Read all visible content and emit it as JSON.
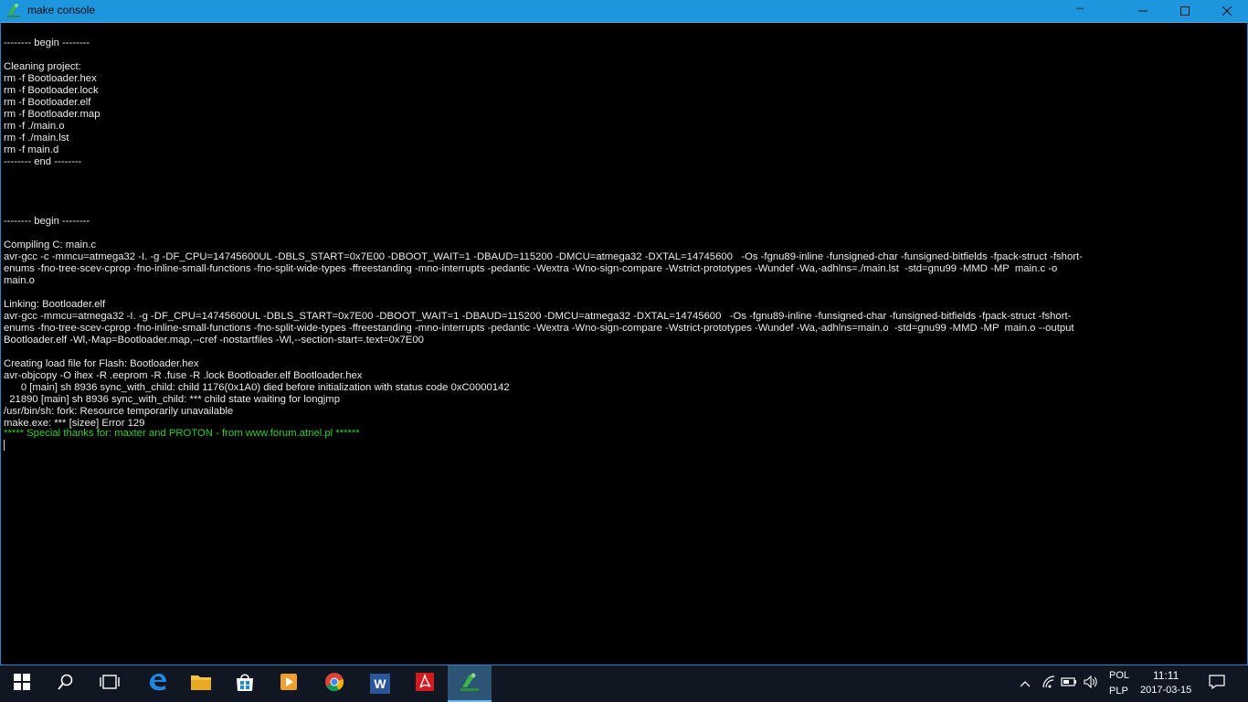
{
  "window": {
    "title": "make console",
    "resize_glyph": "↔",
    "buttons": {
      "minimize": "—",
      "maximize": "☐",
      "close": "✕"
    }
  },
  "console": {
    "lines": [
      "-------- begin --------",
      "",
      "Cleaning project:",
      "rm -f Bootloader.hex",
      "rm -f Bootloader.lock",
      "rm -f Bootloader.elf",
      "rm -f Bootloader.map",
      "rm -f ./main.o",
      "rm -f ./main.lst",
      "rm -f main.d",
      "-------- end --------",
      "",
      "",
      "",
      "",
      "-------- begin --------",
      "",
      "Compiling C: main.c",
      "avr-gcc -c -mmcu=atmega32 -I. -g -DF_CPU=14745600UL -DBLS_START=0x7E00 -DBOOT_WAIT=1 -DBAUD=115200 -DMCU=atmega32 -DXTAL=14745600   -Os -fgnu89-inline -funsigned-char -funsigned-bitfields -fpack-struct -fshort-",
      "enums -fno-tree-scev-cprop -fno-inline-small-functions -fno-split-wide-types -ffreestanding -mno-interrupts -pedantic -Wextra -Wno-sign-compare -Wstrict-prototypes -Wundef -Wa,-adhlns=./main.lst  -std=gnu99 -MMD -MP  main.c -o",
      "main.o",
      "",
      "Linking: Bootloader.elf",
      "avr-gcc -mmcu=atmega32 -I. -g -DF_CPU=14745600UL -DBLS_START=0x7E00 -DBOOT_WAIT=1 -DBAUD=115200 -DMCU=atmega32 -DXTAL=14745600   -Os -fgnu89-inline -funsigned-char -funsigned-bitfields -fpack-struct -fshort-",
      "enums -fno-tree-scev-cprop -fno-inline-small-functions -fno-split-wide-types -ffreestanding -mno-interrupts -pedantic -Wextra -Wno-sign-compare -Wstrict-prototypes -Wundef -Wa,-adhlns=main.o  -std=gnu99 -MMD -MP  main.o --output",
      "Bootloader.elf -Wl,-Map=Bootloader.map,--cref -nostartfiles -Wl,--section-start=.text=0x7E00",
      "",
      "Creating load file for Flash: Bootloader.hex",
      "avr-objcopy -O ihex -R .eeprom -R .fuse -R .lock Bootloader.elf Bootloader.hex",
      "      0 [main] sh 8936 sync_with_child: child 1176(0x1A0) died before initialization with status code 0xC0000142",
      "  21890 [main] sh 8936 sync_with_child: *** child state waiting for longjmp",
      "/usr/bin/sh: fork: Resource temporarily unavailable",
      "make.exe: *** [sizee] Error 129"
    ],
    "thanks_line": "***** Special thanks for: maxter and PROTON - from www.forum.atnel.pl ******",
    "thanks_color": "#2fd02f"
  },
  "taskbar": {
    "items": [
      {
        "name": "start",
        "icon": "windows-start-icon"
      },
      {
        "name": "search",
        "icon": "search-icon"
      },
      {
        "name": "task-view",
        "icon": "task-view-icon"
      },
      {
        "name": "edge",
        "icon": "edge-icon"
      },
      {
        "name": "file-explorer",
        "icon": "folder-icon"
      },
      {
        "name": "store",
        "icon": "store-icon"
      },
      {
        "name": "media-player",
        "icon": "media-player-icon"
      },
      {
        "name": "chrome",
        "icon": "chrome-icon"
      },
      {
        "name": "word",
        "icon": "word-icon",
        "label": "W"
      },
      {
        "name": "acrobat",
        "icon": "acrobat-icon"
      },
      {
        "name": "make-console",
        "icon": "make-console-icon",
        "active": true
      }
    ],
    "tray": {
      "language_top": "POL",
      "language_bottom": "PLP",
      "time": "11:11",
      "date": "2017-03-15"
    }
  },
  "colors": {
    "titlebar": "#1e96dd",
    "console_bg": "#000000",
    "console_text": "#ececec",
    "taskbar_bg": "#101622",
    "taskbar_active": "#2b5475"
  }
}
